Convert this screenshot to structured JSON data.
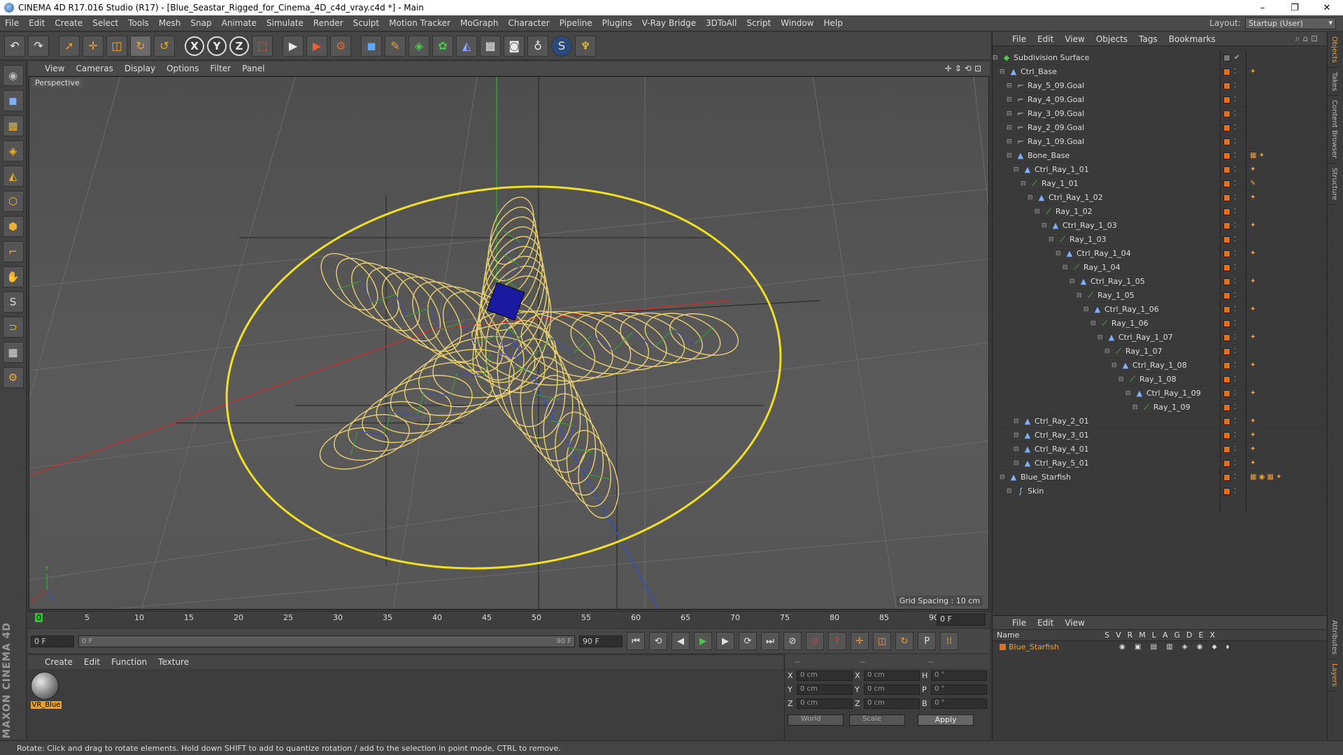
{
  "window": {
    "title": "CINEMA 4D R17.016 Studio (R17) - [Blue_Seastar_Rigged_for_Cinema_4D_c4d_vray.c4d *] - Main",
    "min": "–",
    "max": "❐",
    "close": "✕"
  },
  "menubar": {
    "items": [
      "File",
      "Edit",
      "Create",
      "Select",
      "Tools",
      "Mesh",
      "Snap",
      "Animate",
      "Simulate",
      "Render",
      "Sculpt",
      "Motion Tracker",
      "MoGraph",
      "Character",
      "Pipeline",
      "Plugins",
      "V-Ray Bridge",
      "3DToAll",
      "Script",
      "Window",
      "Help"
    ],
    "layout_label": "Layout:",
    "layout_value": "Startup (User)"
  },
  "toolbar": {
    "undo": "↶",
    "redo": "↷",
    "select": "➚",
    "move": "✛",
    "scale": "◫",
    "rotate": "↻",
    "recent": "↺",
    "axis_x": "X",
    "axis_y": "Y",
    "axis_z": "Z",
    "coord": "⬚",
    "render_view": "▶",
    "render_pv": "▶",
    "render_settings": "⚙",
    "cube": "◼",
    "pen": "✎",
    "subdiv": "◈",
    "cloner": "✿",
    "deformer": "◭",
    "floor": "▦",
    "camera": "◙",
    "light": "♁",
    "vray": "S",
    "python": "♆"
  },
  "leftbar": {
    "tools": [
      "◉",
      "◼",
      "▦",
      "◈",
      "◭",
      "⬡",
      "⬢",
      "⌐",
      "✋",
      "S",
      "⊃",
      "▦",
      "⚙"
    ],
    "brand": "MAXON CINEMA 4D"
  },
  "viewport": {
    "menu": [
      "View",
      "Cameras",
      "Display",
      "Options",
      "Filter",
      "Panel"
    ],
    "nav_icons": "✛⇕⟲⊡",
    "label": "Perspective",
    "grid_spacing": "Grid Spacing : 10 cm",
    "axis_y": "Y",
    "axis_x": "X"
  },
  "timeline": {
    "ticks": [
      "0",
      "5",
      "10",
      "15",
      "20",
      "25",
      "30",
      "35",
      "40",
      "45",
      "50",
      "55",
      "60",
      "65",
      "70",
      "75",
      "80",
      "85",
      "90"
    ],
    "current": "0 F"
  },
  "transport": {
    "start": "0 F",
    "range_start": "0 F",
    "range_end": "90 F",
    "end": "90 F",
    "buttons": [
      "⏮",
      "⟲",
      "◀",
      "▶",
      "▶",
      "⟳",
      "⏭"
    ],
    "key_buttons": [
      "⊘",
      "⊙",
      "?",
      "✛",
      "◫",
      "↻",
      "P",
      "⁞⁞"
    ]
  },
  "materials": {
    "menu": [
      "Create",
      "Edit",
      "Function",
      "Texture"
    ],
    "items": [
      {
        "name": "VR_Blue"
      }
    ]
  },
  "coords": {
    "headers": [
      "--",
      "--",
      "--"
    ],
    "rows": [
      {
        "a": "X",
        "av": "0 cm",
        "b": "X",
        "bv": "0 cm",
        "c": "H",
        "cv": "0 °"
      },
      {
        "a": "Y",
        "av": "0 cm",
        "b": "Y",
        "bv": "0 cm",
        "c": "P",
        "cv": "0 °"
      },
      {
        "a": "Z",
        "av": "0 cm",
        "b": "Z",
        "bv": "0 cm",
        "c": "B",
        "cv": "0 °"
      }
    ],
    "mode": "World",
    "type": "Scale",
    "apply": "Apply"
  },
  "status": "Rotate: Click and drag to rotate elements. Hold down SHIFT to add to quantize rotation / add to the selection in point mode, CTRL to remove.",
  "object_manager": {
    "menu": [
      "File",
      "Edit",
      "View",
      "Objects",
      "Tags",
      "Bookmarks"
    ],
    "right_icons": "⌕⌂⊡",
    "objects": [
      {
        "name": "Subdivision Surface",
        "depth": 0,
        "kind": "sub",
        "tags": ""
      },
      {
        "name": "Ctrl_Base",
        "depth": 1,
        "kind": "null",
        "tags": "✦"
      },
      {
        "name": "Ray_5_09.Goal",
        "depth": 2,
        "kind": "goal",
        "tags": ""
      },
      {
        "name": "Ray_4_09.Goal",
        "depth": 2,
        "kind": "goal",
        "tags": ""
      },
      {
        "name": "Ray_3_09.Goal",
        "depth": 2,
        "kind": "goal",
        "tags": ""
      },
      {
        "name": "Ray_2_09.Goal",
        "depth": 2,
        "kind": "goal",
        "tags": ""
      },
      {
        "name": "Ray_1_09.Goal",
        "depth": 2,
        "kind": "goal",
        "tags": ""
      },
      {
        "name": "Bone_Base",
        "depth": 2,
        "kind": "null",
        "tags": "▦ ✦"
      },
      {
        "name": "Ctrl_Ray_1_01",
        "depth": 3,
        "kind": "null",
        "tags": "✦"
      },
      {
        "name": "Ray_1_01",
        "depth": 4,
        "kind": "bone",
        "tags": "✎"
      },
      {
        "name": "Ctrl_Ray_1_02",
        "depth": 5,
        "kind": "null",
        "tags": "✦"
      },
      {
        "name": "Ray_1_02",
        "depth": 6,
        "kind": "bone",
        "tags": ""
      },
      {
        "name": "Ctrl_Ray_1_03",
        "depth": 7,
        "kind": "null",
        "tags": "✦"
      },
      {
        "name": "Ray_1_03",
        "depth": 8,
        "kind": "bone",
        "tags": ""
      },
      {
        "name": "Ctrl_Ray_1_04",
        "depth": 9,
        "kind": "null",
        "tags": "✦"
      },
      {
        "name": "Ray_1_04",
        "depth": 10,
        "kind": "bone",
        "tags": ""
      },
      {
        "name": "Ctrl_Ray_1_05",
        "depth": 11,
        "kind": "null",
        "tags": "✦"
      },
      {
        "name": "Ray_1_05",
        "depth": 12,
        "kind": "bone",
        "tags": ""
      },
      {
        "name": "Ctrl_Ray_1_06",
        "depth": 13,
        "kind": "null",
        "tags": "✦"
      },
      {
        "name": "Ray_1_06",
        "depth": 14,
        "kind": "bone",
        "tags": ""
      },
      {
        "name": "Ctrl_Ray_1_07",
        "depth": 15,
        "kind": "null",
        "tags": "✦"
      },
      {
        "name": "Ray_1_07",
        "depth": 16,
        "kind": "bone",
        "tags": ""
      },
      {
        "name": "Ctrl_Ray_1_08",
        "depth": 17,
        "kind": "null",
        "tags": "✦"
      },
      {
        "name": "Ray_1_08",
        "depth": 18,
        "kind": "bone",
        "tags": ""
      },
      {
        "name": "Ctrl_Ray_1_09",
        "depth": 19,
        "kind": "null",
        "tags": "✦"
      },
      {
        "name": "Ray_1_09",
        "depth": 20,
        "kind": "bone",
        "tags": ""
      },
      {
        "name": "Ctrl_Ray_2_01",
        "depth": 3,
        "kind": "null",
        "tags": "✦"
      },
      {
        "name": "Ctrl_Ray_3_01",
        "depth": 3,
        "kind": "null",
        "tags": "✦"
      },
      {
        "name": "Ctrl_Ray_4_01",
        "depth": 3,
        "kind": "null",
        "tags": "✦"
      },
      {
        "name": "Ctrl_Ray_5_01",
        "depth": 3,
        "kind": "null",
        "tags": "✦"
      },
      {
        "name": "Blue_Starfish",
        "depth": 1,
        "kind": "null",
        "tags": "▦ ◉ ▦ ✦"
      },
      {
        "name": "Skin",
        "depth": 2,
        "kind": "skin",
        "tags": ""
      }
    ]
  },
  "right_tabs": [
    "Objects",
    "Takes",
    "Content Browser",
    "Structure"
  ],
  "right_tabs_bottom": [
    "Attributes",
    "Layers"
  ],
  "layer_manager": {
    "menu": [
      "File",
      "Edit",
      "View"
    ],
    "name_header": "Name",
    "cols": "SVRMLAGDEX",
    "layers": [
      {
        "name": "Blue_Starfish",
        "color": "#e07020"
      }
    ]
  }
}
